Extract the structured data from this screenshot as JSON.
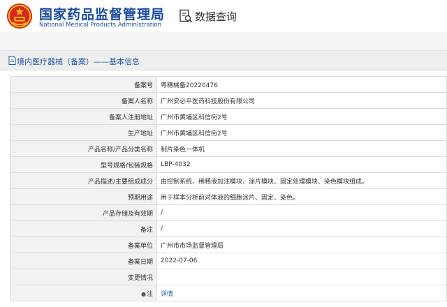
{
  "header": {
    "site_title": "国家药品监督管理局",
    "site_subtitle": "National Medical Products Administration",
    "query_label": "数据查询",
    "brand_color": "#1a4a9e"
  },
  "panel": {
    "title": "境内医疗器械（备案）——基本信息"
  },
  "rows": [
    {
      "label": "备案号",
      "value": "粤穗械备20220476"
    },
    {
      "label": "备案人名称",
      "value": "广州安必平医药科技股份有限公司"
    },
    {
      "label": "备案人注册地址",
      "value": "广州市黄埔区科信街2号"
    },
    {
      "label": "生产地址",
      "value": "广州市黄埔区科信街2号"
    },
    {
      "label": "产品名称/产品分类名称",
      "value": "制片染色一体机"
    },
    {
      "label": "型号规格/包装规格",
      "value": "LBP-4032"
    },
    {
      "label": "产品描述/主要组成成分",
      "value": "由控制系统、稀释液加注模块、涂片模块、固定处理模块、染色模块组成。"
    },
    {
      "label": "预期用途",
      "value": "用于样本分析前对体液的细胞涂片、固定、染色。"
    },
    {
      "label": "产品存储及有效期",
      "value": "/"
    },
    {
      "label": "备注",
      "value": "/"
    },
    {
      "label": "备案单位",
      "value": "广州市市场监督管理局"
    },
    {
      "label": "备案日期",
      "value": "2022-07-06"
    },
    {
      "label": "变更情况",
      "value": ""
    },
    {
      "label": "注",
      "value": "详情"
    }
  ]
}
